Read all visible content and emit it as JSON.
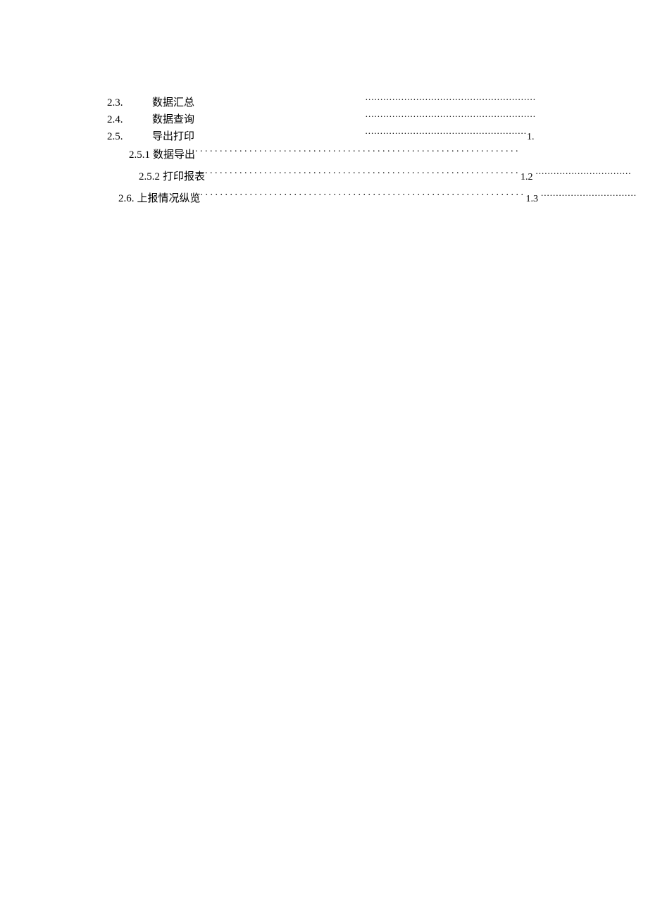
{
  "toc": {
    "e1": {
      "num": "2.3.",
      "title": "数据汇总"
    },
    "e2": {
      "num": "2.4.",
      "title": "数据查询"
    },
    "e3": {
      "num": "2.5.",
      "title": "导出打印",
      "page": "1."
    },
    "e4": {
      "num": "2.5.1",
      "title": "数据导出"
    },
    "e5": {
      "num": "2.5.2",
      "title": "打印报表",
      "page": "1.2"
    },
    "e6": {
      "num": "2.6.",
      "title": "上报情况纵览",
      "page": "1.3"
    }
  }
}
